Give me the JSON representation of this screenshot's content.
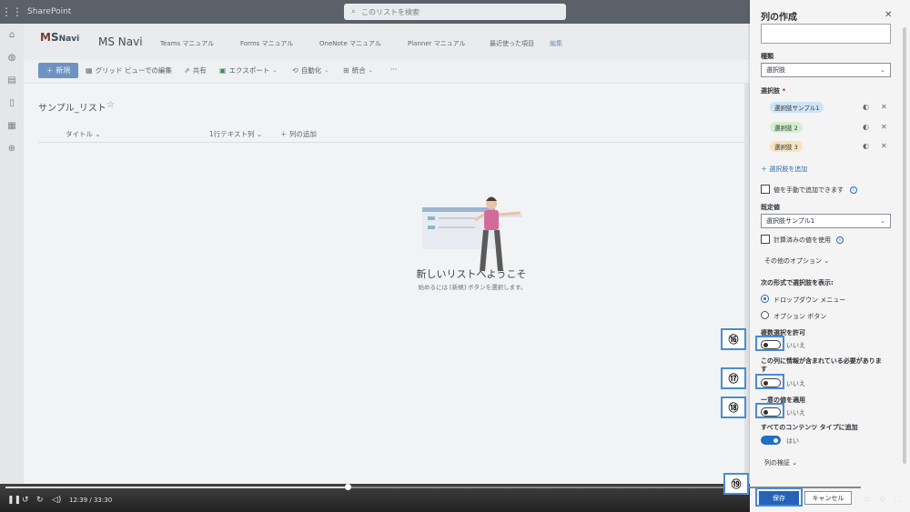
{
  "topbar": {
    "brand": "SharePoint",
    "search_placeholder": "このリストを検索"
  },
  "site": {
    "logo": "MSNavi",
    "logo_m": "M",
    "logo_s": "S",
    "logo_navi": "Navi",
    "name": "MS Navi",
    "nav": [
      "Teams マニュアル",
      "Forms マニュアル",
      "OneNote マニュアル",
      "Planner マニュアル",
      "最近使った項目"
    ],
    "nav_edit": "編集"
  },
  "commands": {
    "new": "新規",
    "grid": "グリッド ビューでの編集",
    "share": "共有",
    "export": "エクスポート",
    "automate": "自動化",
    "integrate": "統合",
    "more": "···"
  },
  "list": {
    "title": "サンプル_リスト",
    "columns": [
      "タイトル",
      "1行テキスト列",
      "列の追加"
    ],
    "welcome": "新しいリストへようこそ",
    "welcome_sub": "始めるには [新規] ボタンを選択します。"
  },
  "panel": {
    "title": "列の作成",
    "type_label": "種類",
    "type_value": "選択肢",
    "choices_label": "選択肢",
    "choices": [
      {
        "label": "選択肢サンプル1",
        "color": "#cfe3f7"
      },
      {
        "label": "選択肢 2",
        "color": "#d3f0cf"
      },
      {
        "label": "選択肢 3",
        "color": "#f7e3bf"
      }
    ],
    "add_choice": "選択肢を追加",
    "manual_values": "値を手動で追加できます",
    "default_label": "既定値",
    "default_value": "選択肢サンプル1",
    "calculated": "計算済みの値を使用",
    "more_options": "その他のオプション",
    "display_label": "次の形式で選択肢を表示:",
    "display_dropdown": "ドロップダウン メニュー",
    "display_radio": "オプション ボタン",
    "multi_label": "複数選択を許可",
    "multi_value": "いいえ",
    "required_label_1": "この列に情報が含まれている必要がありま",
    "required_label_2": "す",
    "required_value": "いいえ",
    "unique_label": "一意の値を適用",
    "unique_value": "いいえ",
    "content_types_label": "すべてのコンテンツ タイプに追加",
    "content_types_value": "はい",
    "validation": "列の検証",
    "save": "保存",
    "cancel": "キャンセル"
  },
  "callouts": [
    "⑯",
    "⑰",
    "⑱",
    "⑲"
  ],
  "video": {
    "time": "12:39 / 33:30",
    "progress": 0.4
  }
}
